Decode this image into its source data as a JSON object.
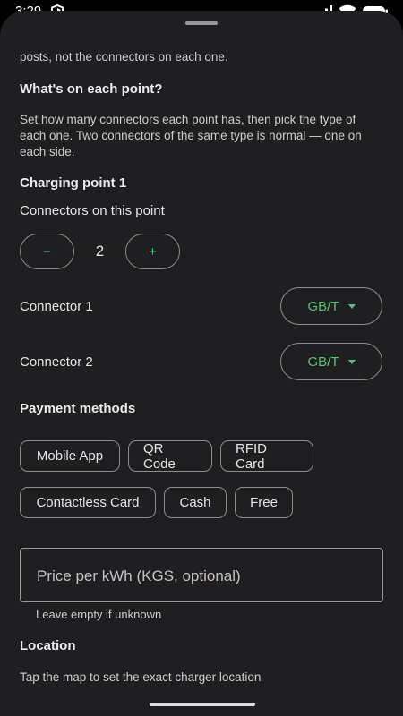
{
  "status_bar": {
    "time": "3:29",
    "icons": [
      "shield-icon",
      "signal-icon",
      "wifi-icon",
      "battery-icon"
    ]
  },
  "intro_tail": "posts, not the connectors on each one.",
  "points_section": {
    "title": "What's on each point?",
    "description": "Set how many connectors each point has, then pick the type of each one. Two connectors of the same type is normal — one on each side."
  },
  "charging_point": {
    "title": "Charging point 1",
    "connectors_label": "Connectors on this point",
    "decrement_label": "−",
    "count": "2",
    "increment_label": "+",
    "connectors": [
      {
        "label": "Connector 1",
        "type": "GB/T"
      },
      {
        "label": "Connector 2",
        "type": "GB/T"
      }
    ]
  },
  "payment": {
    "title": "Payment methods",
    "methods": [
      "Mobile App",
      "QR Code",
      "RFID Card",
      "Contactless Card",
      "Cash",
      "Free"
    ]
  },
  "price_field": {
    "placeholder": "Price per kWh (KGS, optional)",
    "value": "",
    "helper": "Leave empty if unknown"
  },
  "location": {
    "title": "Location",
    "hint": "Tap the map to set the exact charger location"
  },
  "colors": {
    "sheet_background": "#1f1f21",
    "accent_green": "#4cc86e",
    "outline": "#8f8c8c",
    "text": "#e6e3e3"
  }
}
